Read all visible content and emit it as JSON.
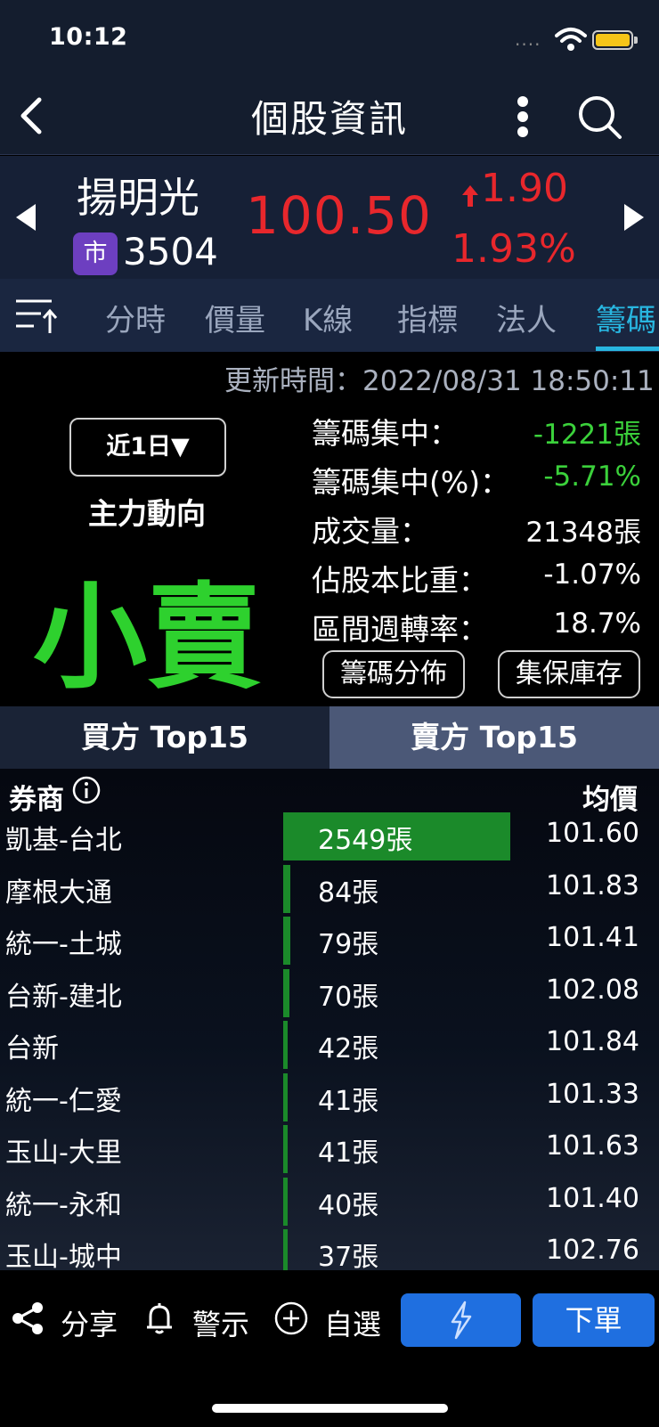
{
  "status_bar": {
    "time": "10:12",
    "signal": "····"
  },
  "nav": {
    "title": "個股資訊"
  },
  "stock": {
    "name": "揚明光",
    "market_badge": "市",
    "code": "3504",
    "price": "100.50",
    "change": "1.90",
    "change_pct": "1.93%",
    "change_direction": "up",
    "color_up": "#e8272c"
  },
  "tabs": [
    "分時",
    "價量",
    "K線",
    "指標",
    "法人",
    "籌碼"
  ],
  "active_tab": "籌碼",
  "summary": {
    "update_time": "更新時間：2022/08/31 18:50:11",
    "period": "近1日▼",
    "main_force_label": "主力動向",
    "main_force_value": "小賣",
    "stats": [
      {
        "label": "籌碼集中：",
        "value": "-1221張"
      },
      {
        "label": "籌碼集中(%)：",
        "value": "-5.71%"
      },
      {
        "label": "成交量：",
        "value": "21348張"
      },
      {
        "label": "佔股本比重：",
        "value": "-1.07%"
      },
      {
        "label": "區間週轉率：",
        "value": "18.7%"
      }
    ],
    "buttons": [
      "籌碼分佈",
      "集保庫存"
    ]
  },
  "buy_sell_tabs": {
    "buy": "買方 Top15",
    "sell": "賣方 Top15",
    "active": "sell"
  },
  "table": {
    "header_broker": "券商",
    "header_avg": "均價",
    "bar_max_lots": 2549,
    "rows": [
      {
        "broker": "凱基-台北",
        "volume": "2549張",
        "lots": 2549,
        "avg_price": "101.60"
      },
      {
        "broker": "摩根大通",
        "volume": "84張",
        "lots": 84,
        "avg_price": "101.83"
      },
      {
        "broker": "統一-土城",
        "volume": "79張",
        "lots": 79,
        "avg_price": "101.41"
      },
      {
        "broker": "台新-建北",
        "volume": "70張",
        "lots": 70,
        "avg_price": "102.08"
      },
      {
        "broker": "台新",
        "volume": "42張",
        "lots": 42,
        "avg_price": "101.84"
      },
      {
        "broker": "統一-仁愛",
        "volume": "41張",
        "lots": 41,
        "avg_price": "101.33"
      },
      {
        "broker": "玉山-大里",
        "volume": "41張",
        "lots": 41,
        "avg_price": "101.63"
      },
      {
        "broker": "統一-永和",
        "volume": "40張",
        "lots": 40,
        "avg_price": "101.40"
      },
      {
        "broker": "玉山-城中",
        "volume": "37張",
        "lots": 37,
        "avg_price": "102.76"
      }
    ]
  },
  "bottom": {
    "share": "分享",
    "alert": "警示",
    "watchlist": "自選",
    "order": "下單"
  },
  "colors": {
    "down_green": "#3bd13b",
    "accent_blue": "#1f6fe0",
    "tab_active": "#28b6e0"
  }
}
